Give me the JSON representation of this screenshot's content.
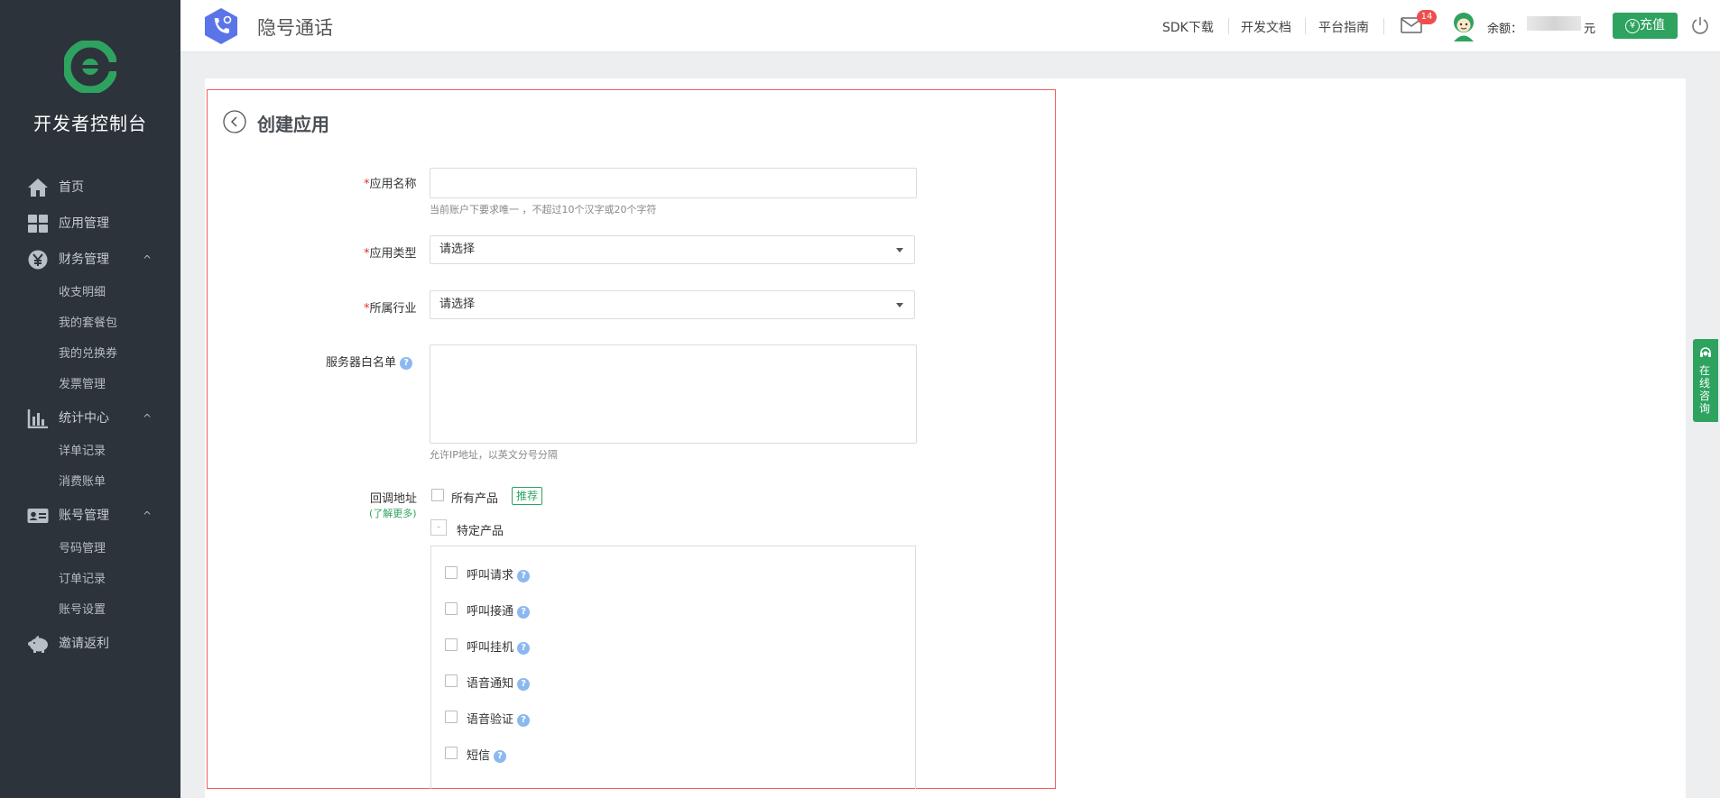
{
  "sidebar": {
    "brand_title": "开发者控制台",
    "items": [
      {
        "label": "首页",
        "icon": "home-icon"
      },
      {
        "label": "应用管理",
        "icon": "grid-icon"
      },
      {
        "label": "财务管理",
        "icon": "yuan-icon",
        "sub": [
          "收支明细",
          "我的套餐包",
          "我的兑换券",
          "发票管理"
        ]
      },
      {
        "label": "统计中心",
        "icon": "bar-chart-icon",
        "sub": [
          "详单记录",
          "消费账单"
        ]
      },
      {
        "label": "账号管理",
        "icon": "id-card-icon",
        "sub": [
          "号码管理",
          "订单记录",
          "账号设置"
        ]
      },
      {
        "label": "邀请返利",
        "icon": "piggy-bank-icon"
      }
    ],
    "chevron": "^"
  },
  "header": {
    "app_title": "隐号通话",
    "links": [
      "SDK下载",
      "开发文档",
      "平台指南"
    ],
    "mail_count": "14",
    "balance_label": "余额：",
    "balance_unit": "元",
    "recharge_label": "充值",
    "recharge_symbol": "¥"
  },
  "form": {
    "title": "创建应用",
    "app_name": {
      "required_mark": "*",
      "label": "应用名称",
      "value": "",
      "hint": "当前账户下要求唯一 ，不超过10个汉字或20个字符"
    },
    "app_type": {
      "required_mark": "*",
      "label": "应用类型",
      "value": "请选择"
    },
    "industry": {
      "required_mark": "*",
      "label": "所属行业",
      "value": "请选择"
    },
    "whitelist": {
      "label": "服务器白名单",
      "value": "",
      "hint": "允许IP地址，以英文分号分隔"
    },
    "callback": {
      "label": "回调地址",
      "learn_more": "(了解更多)",
      "all_products": "所有产品",
      "recommend_tag": "推荐",
      "specific_products": "特定产品",
      "specific_mark": "-",
      "products": [
        "呼叫请求",
        "呼叫接通",
        "呼叫挂机",
        "语音通知",
        "语音验证",
        "短信"
      ]
    },
    "help_mark": "?"
  },
  "online_consult": "在线咨询",
  "colors": {
    "accent": "#2ea360",
    "sidebar_bg": "#2d333b",
    "highlight_border": "#f05f5f",
    "required": "#e02f2f"
  }
}
